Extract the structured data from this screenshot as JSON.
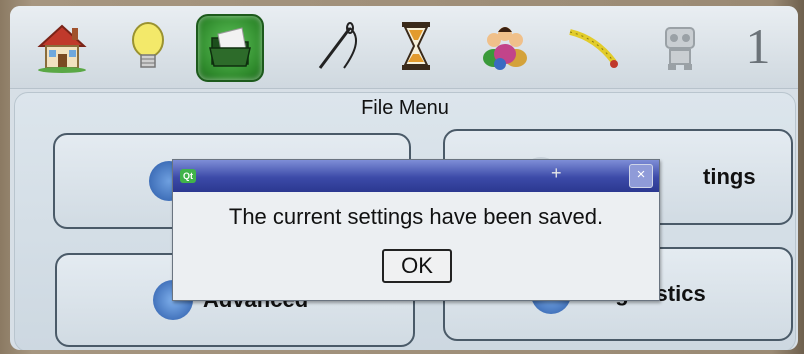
{
  "toolbar": {
    "icons": [
      {
        "name": "home-icon"
      },
      {
        "name": "lightbulb-icon"
      },
      {
        "name": "folder-icon",
        "active": true
      },
      {
        "name": "needle-icon"
      },
      {
        "name": "hourglass-icon"
      },
      {
        "name": "people-icon"
      },
      {
        "name": "tape-measure-icon"
      },
      {
        "name": "robot-icon"
      }
    ],
    "page_number": "1"
  },
  "panel": {
    "title": "File Menu",
    "buttons": [
      {
        "label": ""
      },
      {
        "label": "tings"
      },
      {
        "label": "Advanced"
      },
      {
        "label": "Diagnostics"
      }
    ]
  },
  "dialog": {
    "logo_text": "Qt",
    "close_label": "×",
    "message": "The current settings have been saved.",
    "ok_label": "OK"
  },
  "colors": {
    "titlebar": "#3c4aa8",
    "active_tool": "#2f8a2c",
    "screen_bg": "#d7dfe6"
  }
}
